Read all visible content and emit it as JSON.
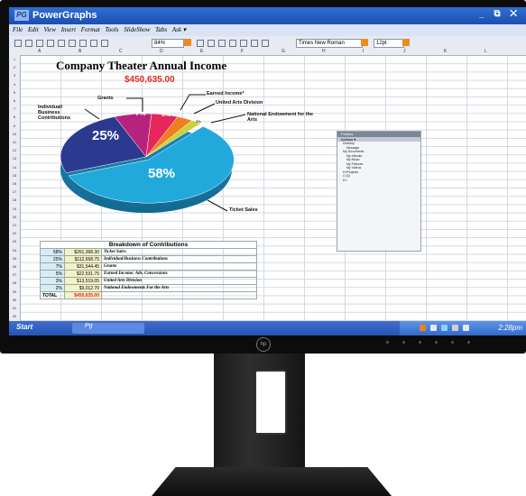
{
  "app": {
    "icon_text": "PG",
    "title": "PowerGraphs",
    "window_controls": "_ ⧉ ✕"
  },
  "menu": [
    "File",
    "Edit",
    "View",
    "Insert",
    "Format",
    "Tools",
    "SlideShow",
    "Tabs",
    "Ask ▾"
  ],
  "toolbar": {
    "zoom": "84%",
    "font": "Times New Roman",
    "size": "12pt"
  },
  "columns": [
    "A",
    "B",
    "C",
    "D",
    "E",
    "F",
    "G",
    "H",
    "I",
    "J",
    "K",
    "L"
  ],
  "rows": [
    "1",
    "2",
    "3",
    "4",
    "5",
    "6",
    "7",
    "8",
    "9",
    "10",
    "11",
    "12",
    "13",
    "14",
    "15",
    "16",
    "17",
    "18",
    "19",
    "20",
    "21",
    "22",
    "23",
    "24",
    "25",
    "26",
    "27",
    "28",
    "29",
    "30",
    "31",
    "32"
  ],
  "sheet": {
    "title": "Company Theater Annual Income",
    "total": "$450,635.00"
  },
  "chart_data": {
    "type": "pie",
    "title": "Company Theater Annual Income",
    "categories": [
      "Ticket Sales",
      "Individual/ Business Contributions",
      "Grants",
      "Earned Income*",
      "United Arts Division",
      "National Endowment for the Arts"
    ],
    "values": [
      58,
      25,
      7,
      5,
      3,
      2
    ],
    "labels": [
      "58%",
      "25%",
      "7%",
      "5%",
      "3%",
      "2%"
    ],
    "colors": [
      "#22a9dc",
      "#2b3a8f",
      "#b8227f",
      "#e8265a",
      "#f07d1f",
      "#c9d23a"
    ]
  },
  "table": {
    "title": "Breakdown of Contributions",
    "rows": [
      {
        "pct": "58%",
        "amount": "$261,368.30",
        "desc": "Ticket Sales"
      },
      {
        "pct": "25%",
        "amount": "$112,658.75",
        "desc": "Individual/Business Contributions"
      },
      {
        "pct": "7%",
        "amount": "$31,544.45",
        "desc": "Grants"
      },
      {
        "pct": "5%",
        "amount": "$22,531.75",
        "desc": "Earned Income: Ads, Concessions"
      },
      {
        "pct": "3%",
        "amount": "$13,519.05",
        "desc": "United Arts Division"
      },
      {
        "pct": "2%",
        "amount": "$9,012.70",
        "desc": "National Endowments For the Arts"
      }
    ],
    "total_label": "TOTAL",
    "total_amount": "$450,635.00"
  },
  "folder_panel": {
    "title": "Folders",
    "subtitle": "Actions ▾",
    "items": [
      "Desktop",
      "Message",
      "My Documents",
      "My eBooks",
      "My Music",
      "My Pictures",
      "My Videos",
      "H:\\Projects",
      "C:\\(I)",
      "D:\\"
    ]
  },
  "taskbar": {
    "start": "Start",
    "task": "Pg",
    "clock": "2:28pm"
  },
  "brand": "hp"
}
